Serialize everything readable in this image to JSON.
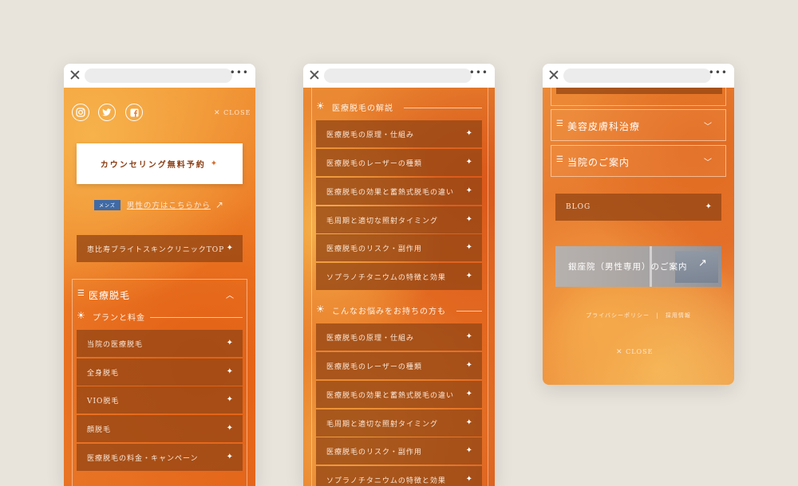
{
  "phone1": {
    "social": [
      "instagram-icon",
      "twitter-icon",
      "facebook-icon"
    ],
    "close_label": "CLOSE",
    "reserve_label": "カウンセリング無料予約",
    "mens_badge": "メンズ",
    "mens_link": "男性の方はこちらから",
    "top_button": "恵比寿ブライトスキンクリニックTOP",
    "accordion_title": "医療脱毛",
    "section_title": "プランと料金",
    "items": [
      "当院の医療脱毛",
      "全身脱毛",
      "VIO脱毛",
      "顔脱毛",
      "医療脱毛の料金・キャンペーン"
    ]
  },
  "phone2": {
    "section1_title": "医療脱毛の解説",
    "section1_items": [
      "医療脱毛の原理・仕組み",
      "医療脱毛のレーザーの種類",
      "医療脱毛の効果と蓄熱式脱毛の違い",
      "毛周期と適切な照射タイミング",
      "医療脱毛のリスク・副作用",
      "ソプラノチタニウムの特徴と効果"
    ],
    "section2_title": "こんなお悩みをお持ちの方も",
    "section2_items": [
      "医療脱毛の原理・仕組み",
      "医療脱毛のレーザーの種類",
      "医療脱毛の効果と蓄熱式脱毛の違い",
      "毛周期と適切な照射タイミング",
      "医療脱毛のリスク・副作用",
      "ソプラノチタニウムの特徴と効果"
    ]
  },
  "phone3": {
    "accordion1": "美容皮膚科治療",
    "accordion2": "当院のご案内",
    "blog_label": "BLOG",
    "banner_label": "銀座院（男性専用）のご案内",
    "privacy_label": "プライバシーポリシー",
    "separator": "|",
    "recruit_label": "採用情報",
    "close_label": "CLOSE"
  },
  "chrome": {
    "dots": "•••"
  }
}
